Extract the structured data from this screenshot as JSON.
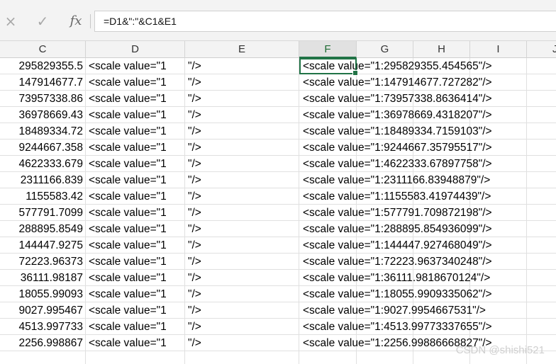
{
  "formula_bar": {
    "cancel_icon": "×",
    "enter_icon": "✓",
    "fx_label": "fx",
    "formula": "=D1&\":\"&C1&E1"
  },
  "columns": [
    {
      "label": "C"
    },
    {
      "label": "D"
    },
    {
      "label": "E"
    },
    {
      "label": "F"
    },
    {
      "label": "G"
    },
    {
      "label": "H"
    },
    {
      "label": "I"
    },
    {
      "label": "J"
    }
  ],
  "active_column": "F",
  "rows": [
    {
      "c": "295829355.5",
      "d": "<scale value=\"1",
      "e": "\"/>",
      "f": "<scale value=\"1:295829355.454565\"/>"
    },
    {
      "c": "147914677.7",
      "d": "<scale value=\"1",
      "e": "\"/>",
      "f": "<scale value=\"1:147914677.727282\"/>"
    },
    {
      "c": "73957338.86",
      "d": "<scale value=\"1",
      "e": "\"/>",
      "f": "<scale value=\"1:73957338.8636414\"/>"
    },
    {
      "c": "36978669.43",
      "d": "<scale value=\"1",
      "e": "\"/>",
      "f": "<scale value=\"1:36978669.4318207\"/>"
    },
    {
      "c": "18489334.72",
      "d": "<scale value=\"1",
      "e": "\"/>",
      "f": "<scale value=\"1:18489334.7159103\"/>"
    },
    {
      "c": "9244667.358",
      "d": "<scale value=\"1",
      "e": "\"/>",
      "f": "<scale value=\"1:9244667.35795517\"/>"
    },
    {
      "c": "4622333.679",
      "d": "<scale value=\"1",
      "e": "\"/>",
      "f": "<scale value=\"1:4622333.67897758\"/>"
    },
    {
      "c": "2311166.839",
      "d": "<scale value=\"1",
      "e": "\"/>",
      "f": "<scale value=\"1:2311166.83948879\"/>"
    },
    {
      "c": "1155583.42",
      "d": "<scale value=\"1",
      "e": "\"/>",
      "f": "<scale value=\"1:1155583.41974439\"/>"
    },
    {
      "c": "577791.7099",
      "d": "<scale value=\"1",
      "e": "\"/>",
      "f": "<scale value=\"1:577791.709872198\"/>"
    },
    {
      "c": "288895.8549",
      "d": "<scale value=\"1",
      "e": "\"/>",
      "f": "<scale value=\"1:288895.854936099\"/>"
    },
    {
      "c": "144447.9275",
      "d": "<scale value=\"1",
      "e": "\"/>",
      "f": "<scale value=\"1:144447.927468049\"/>"
    },
    {
      "c": "72223.96373",
      "d": "<scale value=\"1",
      "e": "\"/>",
      "f": "<scale value=\"1:72223.9637340248\"/>"
    },
    {
      "c": "36111.98187",
      "d": "<scale value=\"1",
      "e": "\"/>",
      "f": "<scale value=\"1:36111.9818670124\"/>"
    },
    {
      "c": "18055.99093",
      "d": "<scale value=\"1",
      "e": "\"/>",
      "f": "<scale value=\"1:18055.9909335062\"/>"
    },
    {
      "c": "9027.995467",
      "d": "<scale value=\"1",
      "e": "\"/>",
      "f": "<scale value=\"1:9027.9954667531\"/>"
    },
    {
      "c": "4513.997733",
      "d": "<scale value=\"1",
      "e": "\"/>",
      "f": "<scale value=\"1:4513.99773337655\"/>"
    },
    {
      "c": "2256.998867",
      "d": "<scale value=\"1",
      "e": "\"/>",
      "f": "<scale value=\"1:2256.99886668827\"/>"
    }
  ],
  "watermark": "CSDN @shishi521",
  "colors": {
    "accent": "#217346"
  }
}
